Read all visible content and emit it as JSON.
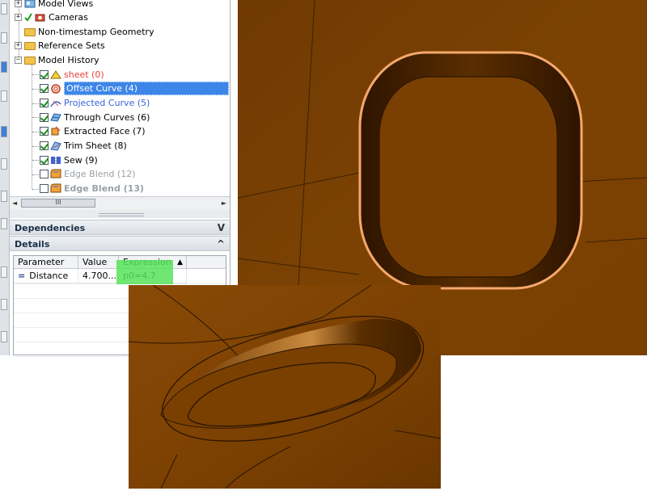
{
  "tree": {
    "items": [
      {
        "label": "Model Views",
        "color": "#000000",
        "checked": null
      },
      {
        "label": "Cameras",
        "color": "#000000",
        "checked": null
      },
      {
        "label": "Non-timestamp Geometry",
        "color": "#000000",
        "checked": null
      },
      {
        "label": "Reference Sets",
        "color": "#000000",
        "checked": null
      },
      {
        "label": "Model History",
        "color": "#000000",
        "checked": null
      },
      {
        "label": "sheet (0)",
        "color": "#e8403a",
        "checked": true
      },
      {
        "label": "Offset Curve (4)",
        "color": "#ffffff",
        "checked": true,
        "selected": true
      },
      {
        "label": "Projected Curve (5)",
        "color": "#3a63d6",
        "checked": true
      },
      {
        "label": "Through Curves (6)",
        "color": "#000000",
        "checked": true
      },
      {
        "label": "Extracted Face (7)",
        "color": "#000000",
        "checked": true
      },
      {
        "label": "Trim Sheet (8)",
        "color": "#000000",
        "checked": true
      },
      {
        "label": "Sew (9)",
        "color": "#000000",
        "checked": true
      },
      {
        "label": "Edge Blend (12)",
        "color": "#9aa0a6",
        "checked": false
      },
      {
        "label": "Edge Blend (13)",
        "color": "#9aa0a6",
        "checked": false
      }
    ],
    "expand_plus": "+",
    "expand_minus": "−"
  },
  "hscroll": {
    "left_arrow": "◄",
    "right_arrow": "►",
    "thumb_label": "III"
  },
  "sections": {
    "dependencies": {
      "label": "Dependencies",
      "chevron": "V"
    },
    "details": {
      "label": "Details",
      "chevron": "^"
    }
  },
  "details_table": {
    "columns": [
      "Parameter",
      "Value",
      "Expression"
    ],
    "sort_indicator": "▲",
    "rows": [
      {
        "parameter": "Distance",
        "parameter_symbol": "=",
        "value": "4.700...",
        "expression": "p0=4.7"
      }
    ],
    "highlight_color": "#57e35b"
  },
  "colors": {
    "selection": "#3d86e8",
    "surface": "#7a3f00",
    "surface_light": "#a45c0d",
    "highlight_curve": "#f5a86b",
    "edge_line": "#333333"
  }
}
